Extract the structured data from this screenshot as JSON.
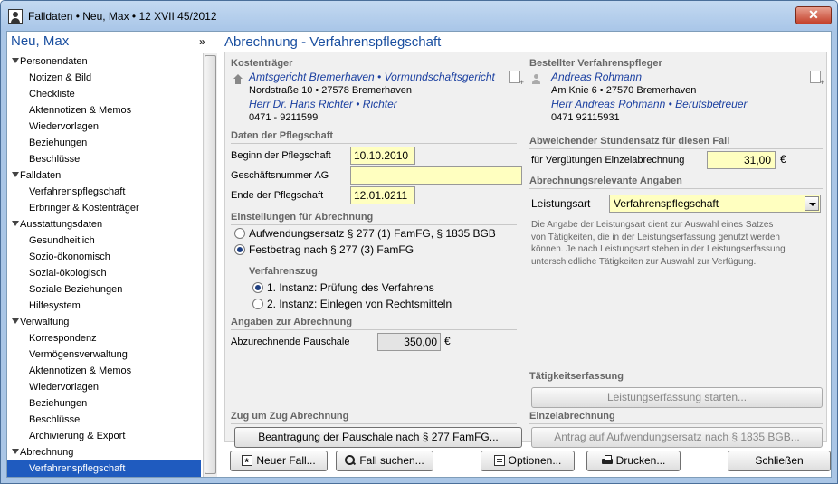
{
  "window": {
    "title": "Falldaten  •  Neu, Max  •  12 XVII 45/2012",
    "close_label": "✕"
  },
  "sidebar": {
    "title": "Neu, Max",
    "collapse_glyph": "»",
    "items": [
      {
        "label": "Personendaten",
        "group": true
      },
      {
        "label": "Notizen & Bild"
      },
      {
        "label": "Checkliste"
      },
      {
        "label": "Aktennotizen & Memos"
      },
      {
        "label": "Wiedervorlagen"
      },
      {
        "label": "Beziehungen"
      },
      {
        "label": "Beschlüsse"
      },
      {
        "label": "Falldaten",
        "group": true
      },
      {
        "label": "Verfahrenspflegschaft"
      },
      {
        "label": "Erbringer & Kostenträger"
      },
      {
        "label": "Ausstattungsdaten",
        "group": true
      },
      {
        "label": "Gesundheitlich"
      },
      {
        "label": "Sozio-ökonomisch"
      },
      {
        "label": "Sozial-ökologisch"
      },
      {
        "label": "Soziale Beziehungen"
      },
      {
        "label": "Hilfesystem"
      },
      {
        "label": "Verwaltung",
        "group": true
      },
      {
        "label": "Korrespondenz"
      },
      {
        "label": "Vermögensverwaltung"
      },
      {
        "label": "Aktennotizen & Memos"
      },
      {
        "label": "Wiedervorlagen"
      },
      {
        "label": "Beziehungen"
      },
      {
        "label": "Beschlüsse"
      },
      {
        "label": "Archivierung & Export"
      },
      {
        "label": "Abrechnung",
        "group": true
      },
      {
        "label": "Verfahrenspflegschaft",
        "selected": true
      }
    ]
  },
  "main": {
    "title": "Abrechnung - Verfahrenspflegschaft",
    "kostentraeger": {
      "heading": "Kostenträger",
      "name": "Amtsgericht Bremerhaven • Vormundschaftsgericht",
      "address": "Nordstraße 10 • 27578 Bremerhaven",
      "contact": "Herr Dr. Hans Richter • Richter",
      "phone": "0471 - 9211599"
    },
    "verfahrenspfleger": {
      "heading": "Bestellter Verfahrenspfleger",
      "name": "Andreas Rohmann",
      "address": "Am Knie 6 • 27570 Bremerhaven",
      "contact": "Herr Andreas Rohmann • Berufsbetreuer",
      "phone": "0471 92115931"
    },
    "pflegschaft": {
      "heading": "Daten der Pflegschaft",
      "beginn_label": "Beginn der Pflegschaft",
      "beginn_value": "10.10.2010",
      "aktenzeichen_label": "Geschäftsnummer AG",
      "aktenzeichen_value": "",
      "ende_label": "Ende der Pflegschaft",
      "ende_value": "12.01.0211"
    },
    "einstellungen": {
      "heading": "Einstellungen für Abrechnung",
      "option1": "Aufwendungsersatz § 277 (1) FamFG, § 1835 BGB",
      "option2": "Festbetrag nach § 277 (3) FamFG",
      "verfahrenszug_heading": "Verfahrenszug",
      "zug1": "1. Instanz: Prüfung des Verfahrens",
      "zug2": "2. Instanz: Einlegen von Rechtsmitteln"
    },
    "angaben": {
      "heading": "Angaben zur Abrechnung",
      "pauschale_label": "Abzurechnende Pauschale",
      "pauschale_value": "350,00",
      "currency": "€"
    },
    "stundensatz": {
      "heading": "Abweichender Stundensatz für diesen Fall",
      "label": "für Vergütungen Einzelabrechnung",
      "value": "31,00",
      "currency": "€"
    },
    "relevant": {
      "heading": "Abrechnungsrelevante Angaben",
      "leistungsart_label": "Leistungsart",
      "leistungsart_value": "Verfahrenspflegschaft",
      "hint_lines": [
        "Die Angabe der Leistungsart dient zur Auswahl eines Satzes",
        "von Tätigkeiten, die in der Leistungserfassung genutzt werden",
        "können. Je nach Leistungsart stehen in der Leistungserfassung",
        "unterschiedliche Tätigkeiten zur Auswahl zur Verfügung."
      ]
    },
    "taetigkeit": {
      "heading": "Tätigkeitserfassung",
      "button": "Leistungserfassung starten..."
    },
    "zugumzug": {
      "heading": "Zug um Zug Abrechnung",
      "button": "Beantragung der Pauschale nach § 277 FamFG..."
    },
    "einzel": {
      "heading": "Einzelabrechnung",
      "button": "Antrag auf Aufwendungsersatz nach § 1835 BGB..."
    }
  },
  "footer": {
    "new_case": "Neuer Fall...",
    "search_case": "Fall suchen...",
    "options": "Optionen...",
    "print": "Drucken...",
    "close": "Schließen"
  }
}
